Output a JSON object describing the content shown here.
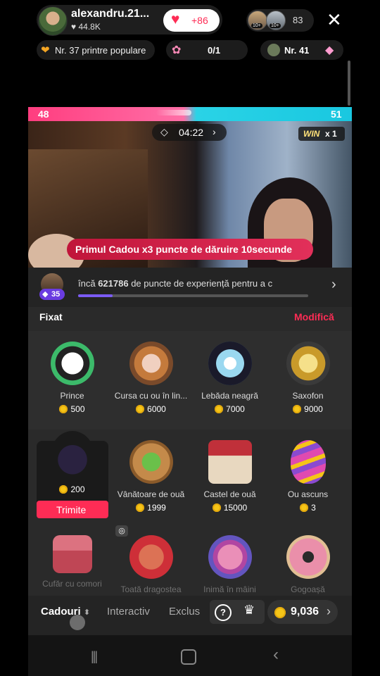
{
  "host": {
    "username": "alexandru.21...",
    "likes": "44.8K",
    "like_count": "+86"
  },
  "viewers": {
    "badge1": "10+",
    "badge2": "10+",
    "count": "83"
  },
  "chips": {
    "popular": "Nr. 37 printre populare",
    "task": "0/1",
    "rank": "Nr. 41"
  },
  "battle": {
    "left_score": "48",
    "right_score": "51",
    "timer": "04:22",
    "win": "WIN",
    "win_multiplier": "x 1"
  },
  "banner": {
    "text": "Primul Cadou x3 puncte de dăruire  10secunde"
  },
  "level": {
    "badge": "35",
    "text_prefix": "încă ",
    "points": "621786",
    "text_suffix": " de puncte de experiență pentru a c",
    "progress_pct": 15
  },
  "section": {
    "pinned": "Fixat",
    "edit": "Modifică"
  },
  "gifts_row1": [
    {
      "name": "Prince",
      "price": "500",
      "icon": "panda-icon"
    },
    {
      "name": "Cursa cu ou în lin...",
      "price": "6000",
      "icon": "bunny-race-icon"
    },
    {
      "name": "Lebăda neagră",
      "price": "7000",
      "icon": "black-swan-icon"
    },
    {
      "name": "Saxofon",
      "price": "9000",
      "icon": "saxophone-icon"
    }
  ],
  "gifts_row2": [
    {
      "name": "",
      "price": "200",
      "icon": "bunny-ears-icon"
    },
    {
      "name": "Vânătoare de ouă",
      "price": "1999",
      "icon": "egg-basket-icon"
    },
    {
      "name": "Castel de ouă",
      "price": "15000",
      "icon": "egg-castle-icon"
    },
    {
      "name": "Ou ascuns",
      "price": "3",
      "icon": "easter-egg-icon"
    }
  ],
  "gifts_row3": [
    {
      "name": "Cufăr cu comori",
      "icon": "treasure-chest-icon"
    },
    {
      "name": "Toată dragostea",
      "icon": "heart-face-icon"
    },
    {
      "name": "Inimă în mâini",
      "icon": "heart-hands-icon"
    },
    {
      "name": "Gogoașă",
      "icon": "donut-icon"
    }
  ],
  "send_label": "Trimite",
  "tabs": {
    "gifts": "Cadouri",
    "interactive": "Interactiv",
    "exclusive": "Exclus"
  },
  "wallet": {
    "coins": "9,036"
  },
  "colors": {
    "accent": "#fe2c55",
    "coin": "#f5c518",
    "progress": "#7b5cf5"
  }
}
